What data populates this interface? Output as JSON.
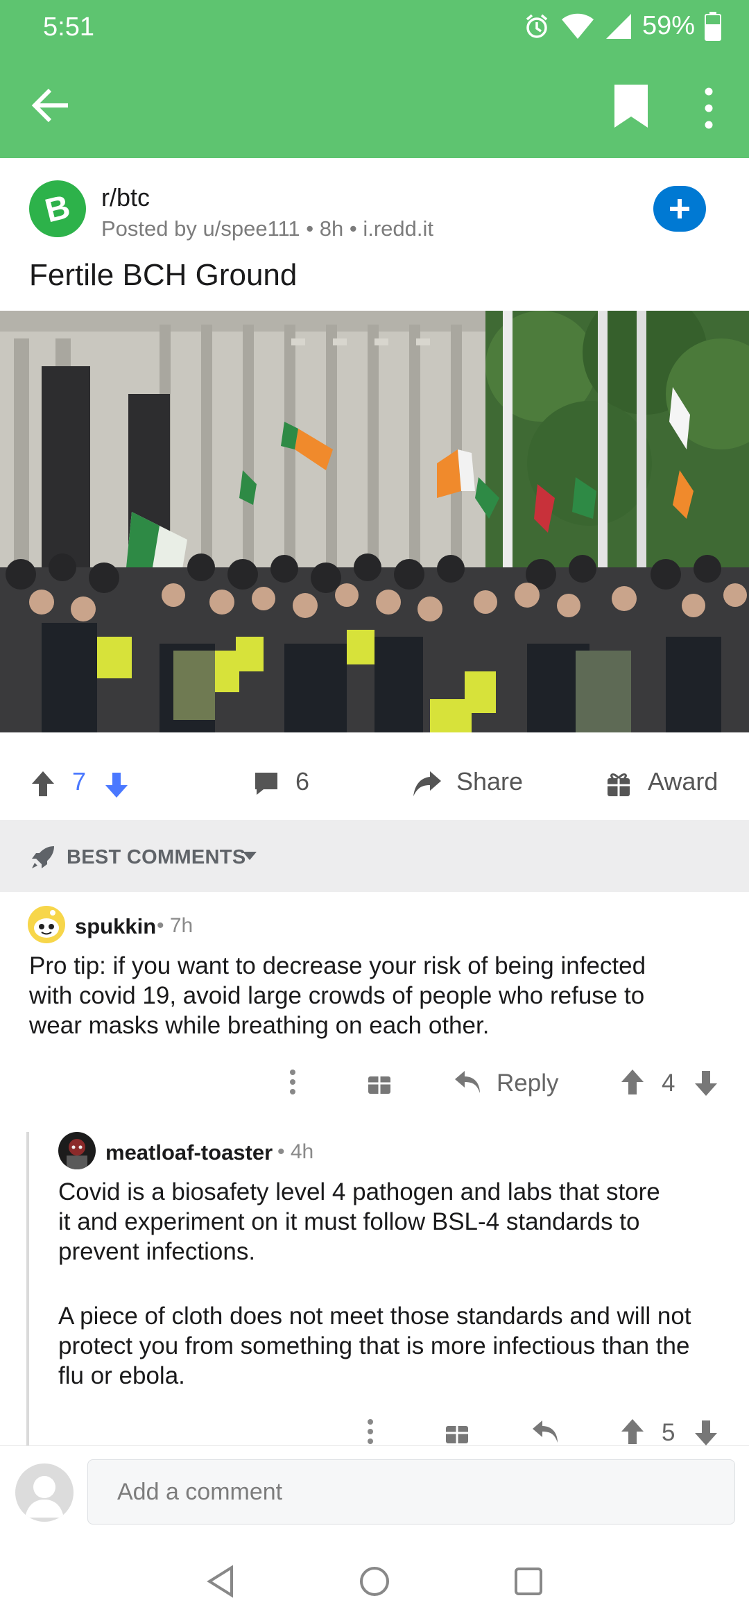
{
  "status_bar": {
    "time": "5:51",
    "battery": "59%"
  },
  "app_bar": {
    "back_icon": "arrow-left-icon",
    "bookmark_icon": "bookmark-icon",
    "more_icon": "more-vertical-icon",
    "color": "#5ec470"
  },
  "post": {
    "subreddit": "r/btc",
    "meta": "Posted by u/spee111 • 8h • i.redd.it",
    "title": "Fertile BCH Ground",
    "vote_count": "7",
    "comment_count": "6",
    "share_label": "Share",
    "award_label": "Award",
    "accent": "#0079d3",
    "vote_color": "#4a78ff"
  },
  "sort": {
    "label": "BEST COMMENTS"
  },
  "comments": [
    {
      "author": "spukkin",
      "time": "• 7h",
      "body_lines": [
        "Pro tip: if you want to decrease your risk of being infected",
        "with covid 19, avoid large crowds of people who refuse to",
        "wear masks while breathing on each other."
      ],
      "reply_label": "Reply",
      "score": "4"
    },
    {
      "author": "meatloaf-toaster",
      "time": "• 4h",
      "body_lines": [
        "Covid is a biosafety level 4 pathogen and labs that store",
        "it and experiment on it must follow BSL-4 standards to",
        "prevent infections.",
        "",
        "A piece of cloth does not meet those standards and will not",
        "protect you from something that is more infectious than the",
        "flu or ebola."
      ],
      "score": "5"
    }
  ],
  "composer": {
    "placeholder": "Add a comment"
  }
}
